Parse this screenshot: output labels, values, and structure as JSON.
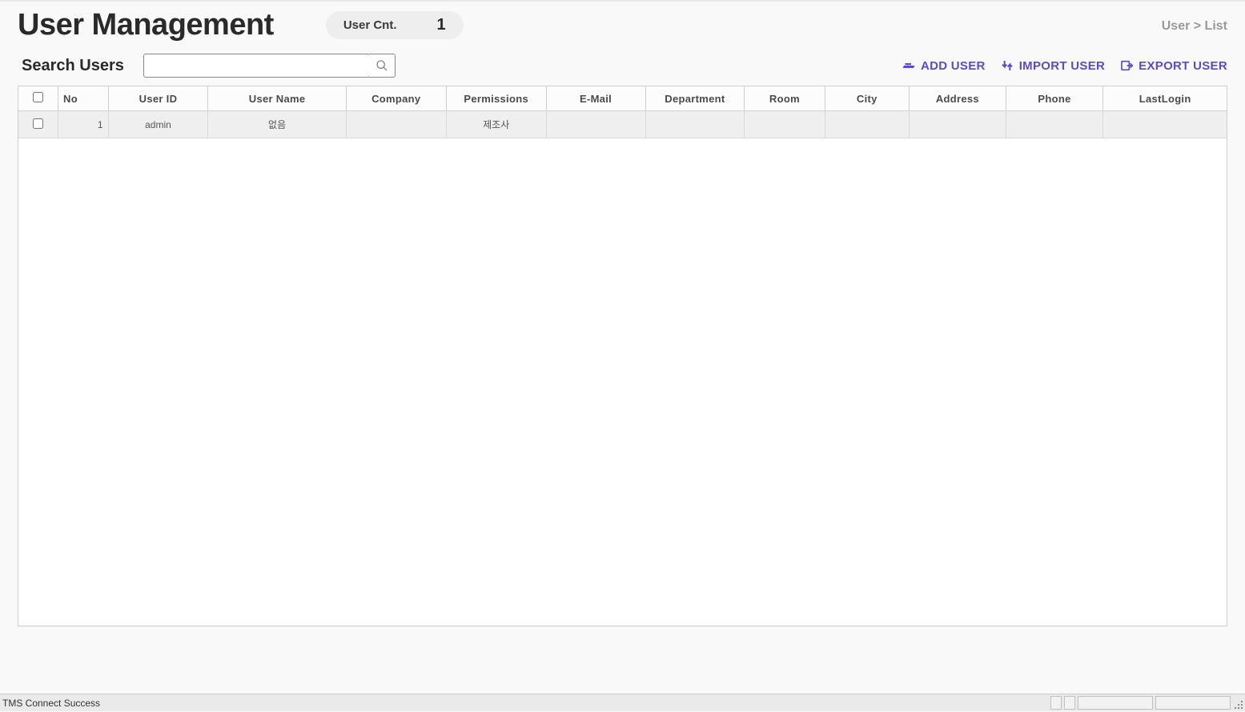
{
  "header": {
    "title": "User Management",
    "count_label": "User Cnt.",
    "count_value": "1",
    "breadcrumb": "User > List"
  },
  "search": {
    "label": "Search Users",
    "value": "",
    "placeholder": ""
  },
  "actions": {
    "add_user": "ADD USER",
    "import_user": "IMPORT USER",
    "export_user": "EXPORT USER"
  },
  "table": {
    "columns": {
      "no": "No",
      "user_id": "User ID",
      "user_name": "User Name",
      "company": "Company",
      "permissions": "Permissions",
      "email": "E-Mail",
      "department": "Department",
      "room": "Room",
      "city": "City",
      "address": "Address",
      "phone": "Phone",
      "last_login": "LastLogin"
    },
    "rows": [
      {
        "no": "1",
        "user_id": "admin",
        "user_name": "없음",
        "company": "",
        "permissions": "제조사",
        "email": "",
        "department": "",
        "room": "",
        "city": "",
        "address": "",
        "phone": "",
        "last_login": ""
      }
    ]
  },
  "status": {
    "text": "TMS Connect Success"
  }
}
